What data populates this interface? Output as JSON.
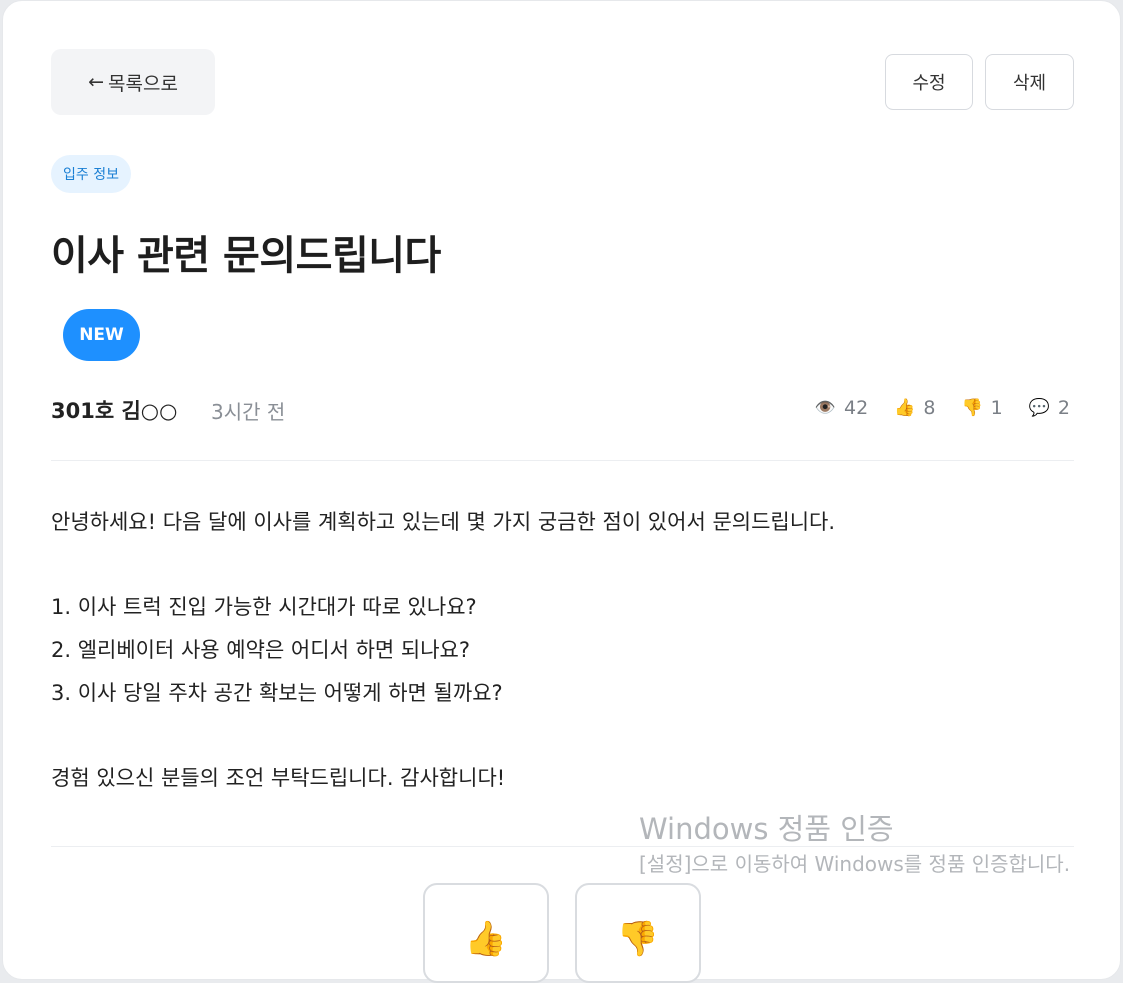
{
  "header": {
    "back_arrow": "←",
    "back_label": "목록으로",
    "edit_label": "수정",
    "delete_label": "삭제"
  },
  "post": {
    "category": "입주 정보",
    "title": "이사 관련 문의드립니다",
    "badge": "NEW",
    "author": "301호 김○○",
    "time": "3시간 전",
    "stats": {
      "views": "42",
      "likes": "8",
      "dislikes": "1",
      "comments": "2"
    },
    "body": {
      "intro": "안녕하세요! 다음 달에 이사를 계획하고 있는데 몇 가지 궁금한 점이 있어서 문의드립니다.",
      "questions": [
        "1. 이사 트럭 진입 가능한 시간대가 따로 있나요?",
        "2. 엘리베이터 사용 예약은 어디서 하면 되나요?",
        "3. 이사 당일 주차 공간 확보는 어떻게 하면 될까요?"
      ],
      "closing": "경험 있으신 분들의 조언 부탁드립니다. 감사합니다!"
    }
  },
  "icons": {
    "views": "👁️",
    "likes": "👍",
    "dislikes": "👎",
    "comments": "💬"
  },
  "watermark": {
    "title": "Windows 정품 인증",
    "text": "[설정]으로 이동하여 Windows를 정품 인증합니다."
  },
  "colors": {
    "accent": "#1e90ff",
    "category_bg": "#e6f3ff",
    "category_text": "#1a7fd4"
  }
}
